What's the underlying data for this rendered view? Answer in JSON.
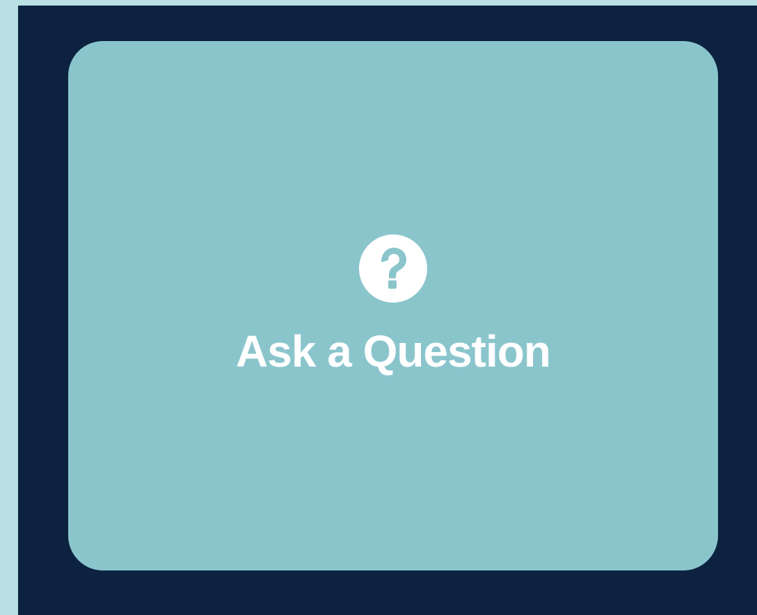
{
  "colors": {
    "page_background": "#b8dfe3",
    "frame_background": "#0c2240",
    "card_background": "#8ac5cc",
    "text": "#ffffff"
  },
  "card": {
    "icon": "question-circle-icon",
    "label": "Ask a Question"
  }
}
